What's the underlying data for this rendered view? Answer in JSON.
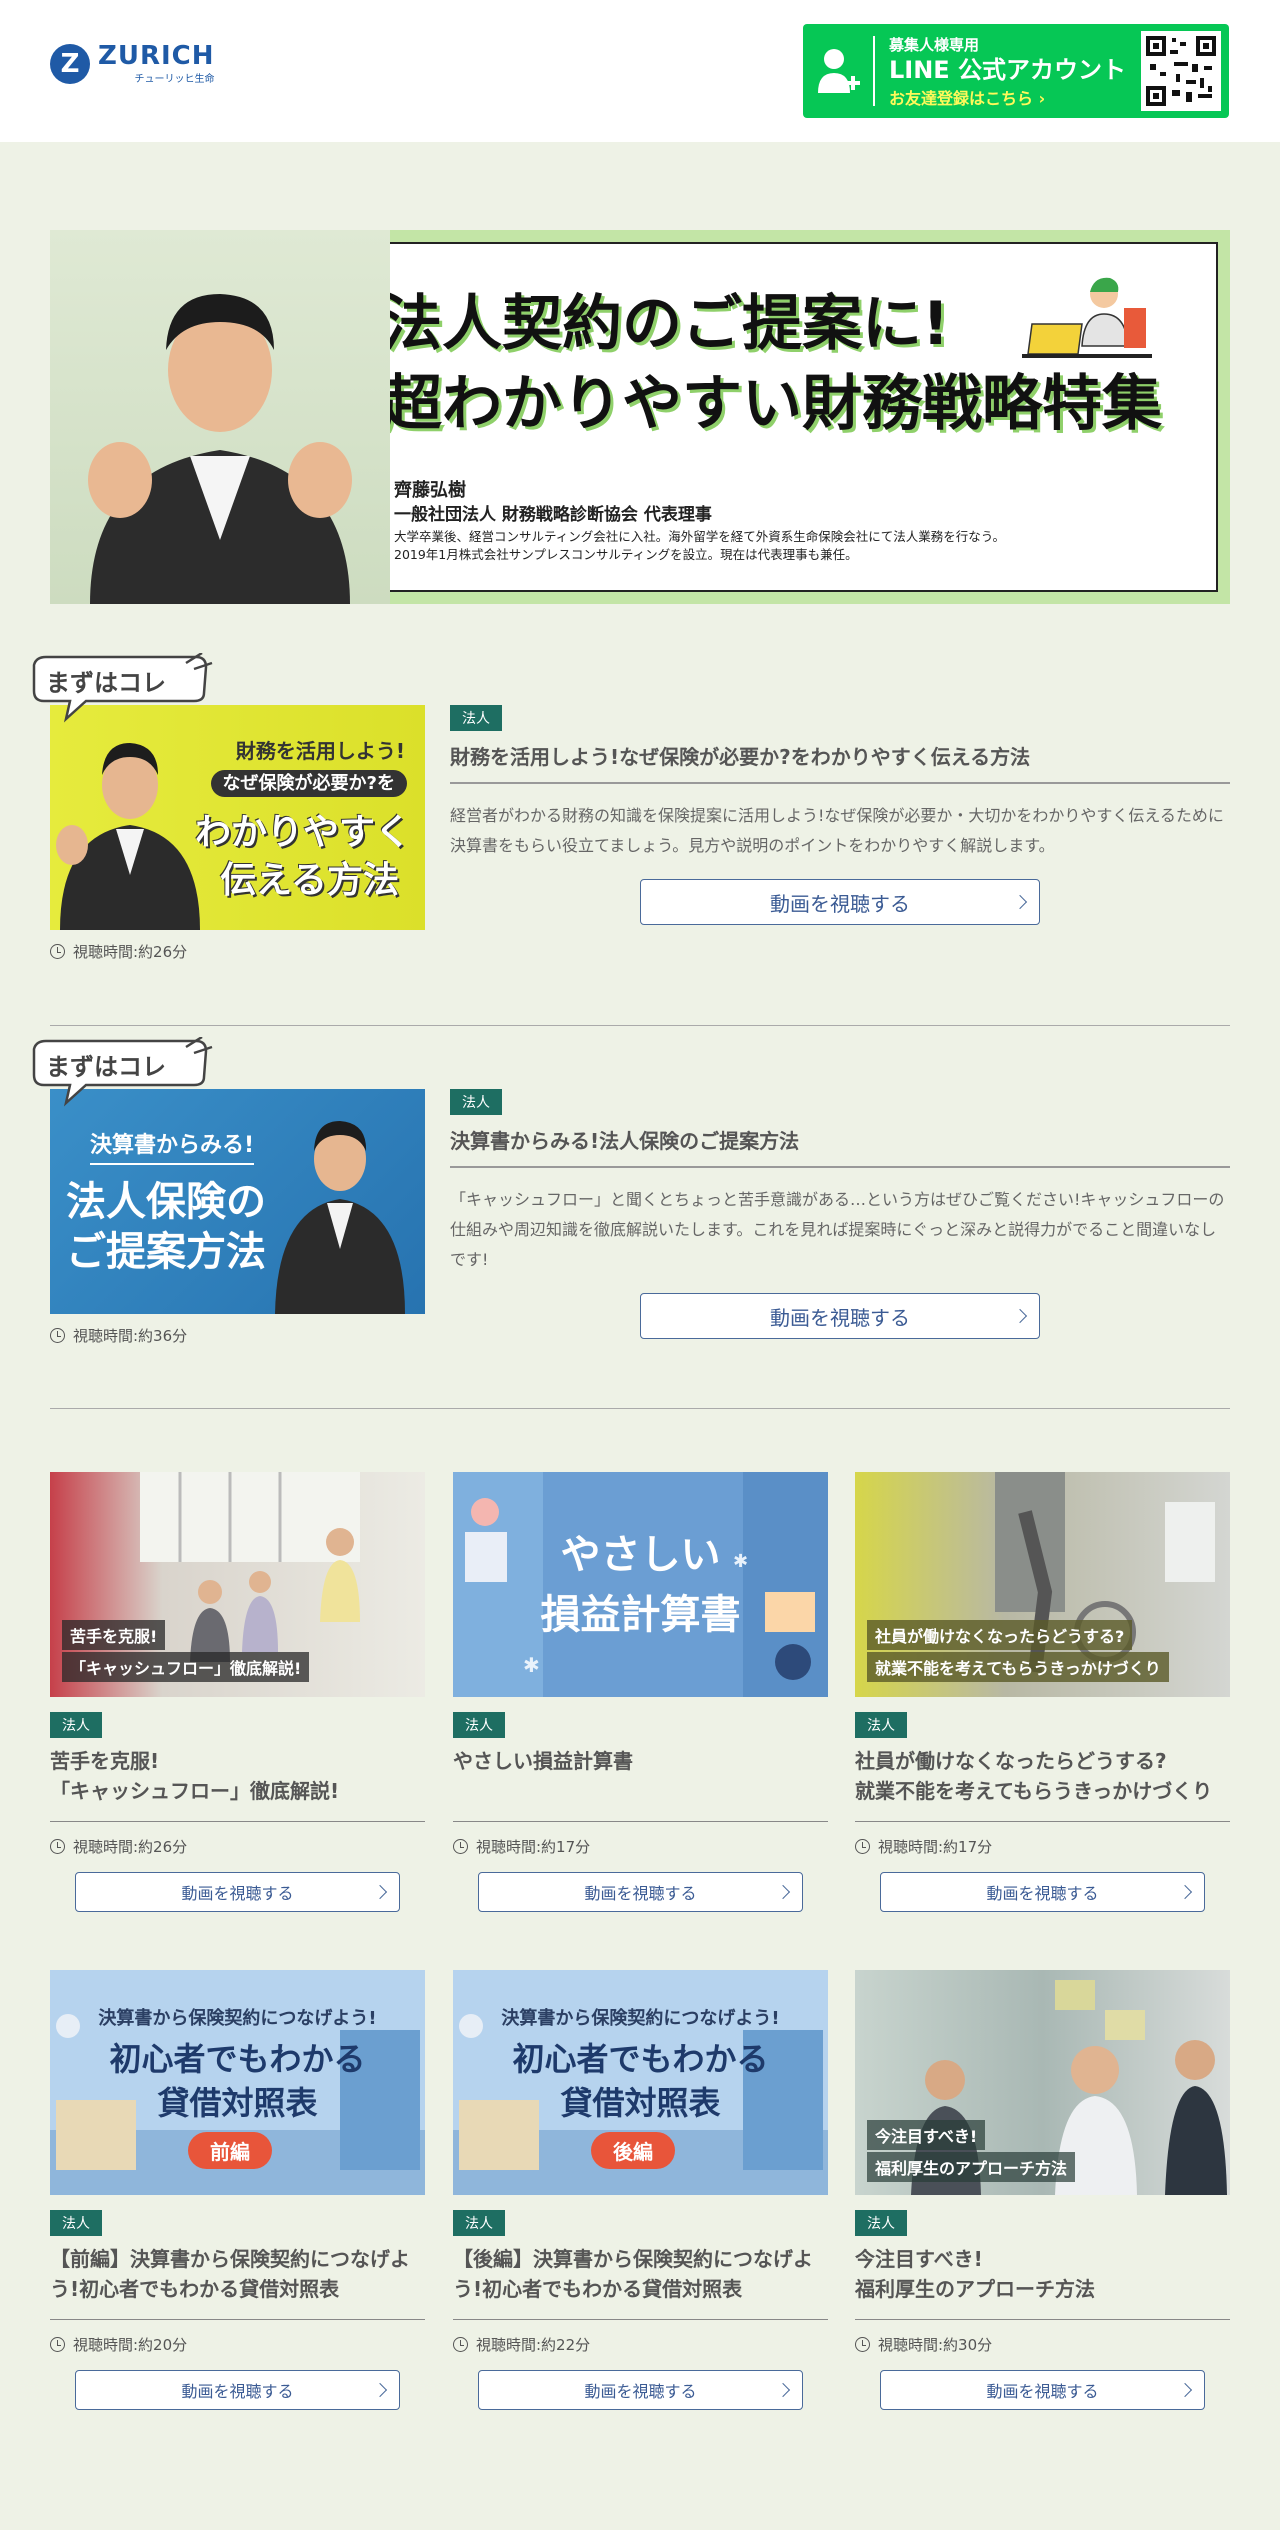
{
  "header": {
    "logo_mark": "Z",
    "logo_name": "ZURICH",
    "logo_sub": "チューリッヒ生命",
    "line_banner": {
      "line1": "募集人様専用",
      "line2": "LINE 公式アカウント",
      "line3": "お友達登録はこちら ›"
    }
  },
  "hero": {
    "title_line1": "法人契約のご提案に!",
    "title_line2": "超わかりやすい財務戦略特集",
    "name": "齊藤弘樹",
    "role": "一般社団法人 財務戦略診断協会 代表理事",
    "desc1": "大学卒業後、経営コンサルティング会社に入社。海外留学を経て外資系生命保険会社にて法人業務を行なう。",
    "desc2": "2019年1月株式会社サンプレスコンサルティングを設立。現在は代表理事も兼任。"
  },
  "featured": [
    {
      "badge": "まずはコレ",
      "thumb_lines": [
        "財務を活用しよう!",
        "なぜ保険が必要か?を",
        "わかりやすく",
        "伝える方法"
      ],
      "tag": "法人",
      "title": "財務を活用しよう!なぜ保険が必要か?をわかりやすく伝える方法",
      "desc": "経営者がわかる財務の知識を保険提案に活用しよう!なぜ保険が必要か・大切かをわかりやすく伝えるために決算書をもらい役立てましょう。見方や説明のポイントをわかりやすく解説します。",
      "button": "動画を視聴する",
      "duration": "視聴時間:約26分"
    },
    {
      "badge": "まずはコレ",
      "thumb_lines": [
        "決算書からみる!",
        "法人保険の",
        "ご提案方法"
      ],
      "tag": "法人",
      "title": "決算書からみる!法人保険のご提案方法",
      "desc": "「キャッシュフロー」と聞くとちょっと苦手意識がある…という方はぜひご覧ください!キャッシュフローの仕組みや周辺知識を徹底解説いたします。これを見れば提案時にぐっと深みと説得力がでること間違いなしです!",
      "button": "動画を視聴する",
      "duration": "視聴時間:約36分"
    }
  ],
  "cards": [
    {
      "thumb_lines": [
        "苦手を克服!",
        "「キャッシュフロー」徹底解説!"
      ],
      "tag": "法人",
      "title": "苦手を克服!\n「キャッシュフロー」徹底解説!",
      "duration": "視聴時間:約26分",
      "button": "動画を視聴する"
    },
    {
      "thumb_lines": [
        "やさしい",
        "損益計算書"
      ],
      "tag": "法人",
      "title": "やさしい損益計算書",
      "duration": "視聴時間:約17分",
      "button": "動画を視聴する"
    },
    {
      "thumb_lines": [
        "社員が働けなくなったらどうする?",
        "就業不能を考えてもらうきっかけづくり"
      ],
      "tag": "法人",
      "title": "社員が働けなくなったらどうする?\n就業不能を考えてもらうきっかけづくり",
      "duration": "視聴時間:約17分",
      "button": "動画を視聴する"
    },
    {
      "thumb_lines": [
        "決算書から保険契約につなげよう!",
        "初心者でもわかる",
        "貸借対照表",
        "前編"
      ],
      "tag": "法人",
      "title": "【前編】決算書から保険契約につなげよう!初心者でもわかる貸借対照表",
      "duration": "視聴時間:約20分",
      "button": "動画を視聴する"
    },
    {
      "thumb_lines": [
        "決算書から保険契約につなげよう!",
        "初心者でもわかる",
        "貸借対照表",
        "後編"
      ],
      "tag": "法人",
      "title": "【後編】決算書から保険契約につなげよう!初心者でもわかる貸借対照表",
      "duration": "視聴時間:約22分",
      "button": "動画を視聴する"
    },
    {
      "thumb_lines": [
        "今注目すべき!",
        "福利厚生のアプローチ方法"
      ],
      "tag": "法人",
      "title": "今注目すべき!\n福利厚生のアプローチ方法",
      "duration": "視聴時間:約30分",
      "button": "動画を視聴する"
    }
  ],
  "colors": {
    "background": "#eef2e6",
    "tag": "#1e6e62",
    "line_green": "#06c755",
    "button_text": "#3b5b94"
  }
}
